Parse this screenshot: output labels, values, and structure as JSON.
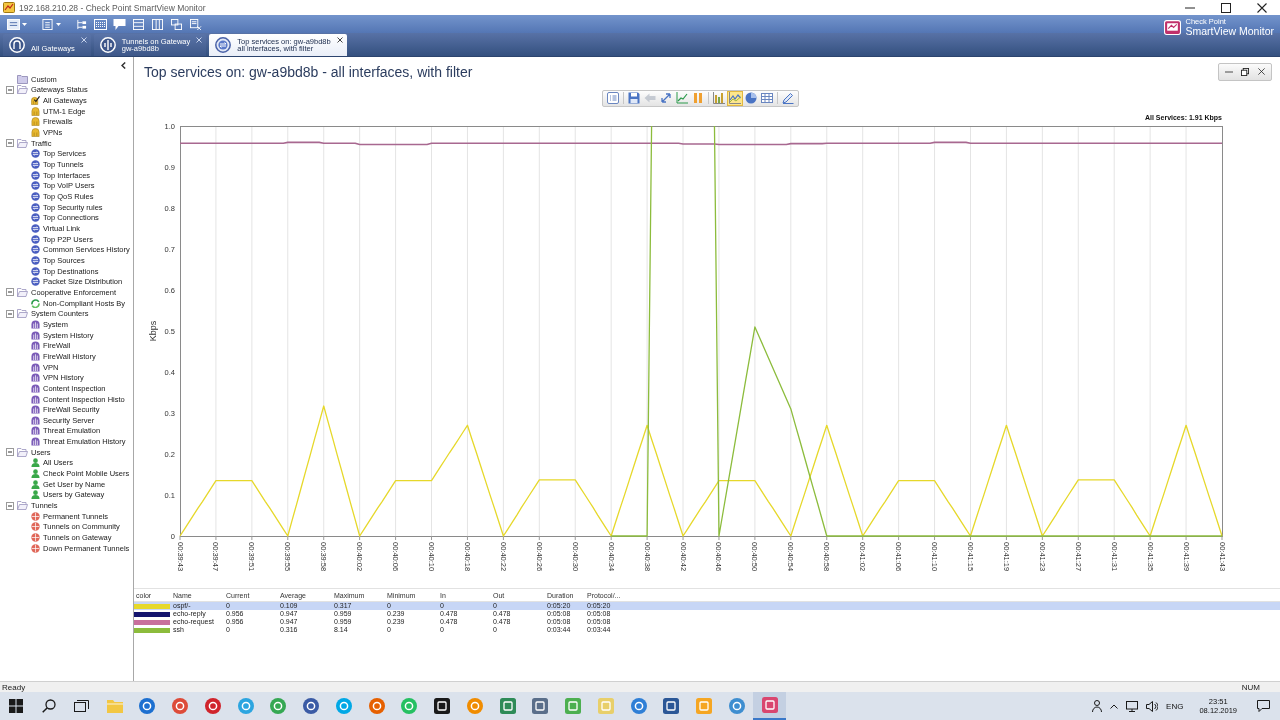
{
  "window": {
    "title": "192.168.210.28 - Check Point SmartView Monitor"
  },
  "tabs": [
    {
      "kind": "gateways",
      "lines": [
        "All Gateways"
      ],
      "selected": false
    },
    {
      "kind": "tunnels",
      "lines": [
        "Tunnels on Gateway",
        "gw-a9bd8b"
      ],
      "selected": false
    },
    {
      "kind": "services",
      "lines": [
        "Top services on: gw-a9bd8b",
        "all interfaces, with filter"
      ],
      "selected": true
    }
  ],
  "logo": {
    "brand": "Check Point",
    "product": "SmartView Monitor"
  },
  "sidebar": {
    "items": [
      {
        "label": "Custom"
      },
      {
        "label": "Gateways Status",
        "expanded": true,
        "children": [
          {
            "label": "All Gateways",
            "kind": "summary"
          },
          {
            "label": "UTM-1 Edge",
            "kind": "gateway"
          },
          {
            "label": "Firewalls",
            "kind": "gateway"
          },
          {
            "label": "VPNs",
            "kind": "gateway"
          }
        ]
      },
      {
        "label": "Traffic",
        "expanded": true,
        "children": [
          {
            "label": "Top Services",
            "kind": "traffic"
          },
          {
            "label": "Top Tunnels",
            "kind": "traffic"
          },
          {
            "label": "Top Interfaces",
            "kind": "traffic"
          },
          {
            "label": "Top VoIP Users",
            "kind": "traffic"
          },
          {
            "label": "Top QoS Rules",
            "kind": "traffic"
          },
          {
            "label": "Top Security rules",
            "kind": "traffic"
          },
          {
            "label": "Top Connections",
            "kind": "traffic"
          },
          {
            "label": "Virtual Link",
            "kind": "traffic"
          },
          {
            "label": "Top P2P Users",
            "kind": "traffic"
          },
          {
            "label": "Common Services History",
            "kind": "traffic"
          },
          {
            "label": "Top Sources",
            "kind": "traffic"
          },
          {
            "label": "Top Destinations",
            "kind": "traffic"
          },
          {
            "label": "Packet Size Distribution",
            "kind": "traffic"
          }
        ]
      },
      {
        "label": "Cooperative Enforcement",
        "expanded": true,
        "children": [
          {
            "label": "Non-Compliant Hosts By",
            "kind": "enforcement"
          }
        ]
      },
      {
        "label": "System Counters",
        "expanded": true,
        "children": [
          {
            "label": "System",
            "kind": "counter"
          },
          {
            "label": "System History",
            "kind": "counter"
          },
          {
            "label": "FireWall",
            "kind": "counter"
          },
          {
            "label": "FireWall History",
            "kind": "counter"
          },
          {
            "label": "VPN",
            "kind": "counter"
          },
          {
            "label": "VPN History",
            "kind": "counter"
          },
          {
            "label": "Content Inspection",
            "kind": "counter"
          },
          {
            "label": "Content Inspection Histo",
            "kind": "counter"
          },
          {
            "label": "FireWall Security",
            "kind": "counter"
          },
          {
            "label": "Security Server",
            "kind": "counter"
          },
          {
            "label": "Threat Emulation",
            "kind": "counter"
          },
          {
            "label": "Threat Emulation History",
            "kind": "counter"
          }
        ]
      },
      {
        "label": "Users",
        "expanded": true,
        "children": [
          {
            "label": "All Users",
            "kind": "user"
          },
          {
            "label": "Check Point Mobile Users",
            "kind": "user"
          },
          {
            "label": "Get User by Name",
            "kind": "user"
          },
          {
            "label": "Users by Gateway",
            "kind": "user"
          }
        ]
      },
      {
        "label": "Tunnels",
        "expanded": true,
        "children": [
          {
            "label": "Permanent Tunnels",
            "kind": "tunnel"
          },
          {
            "label": "Tunnels on Community",
            "kind": "tunnel"
          },
          {
            "label": "Tunnels on Gateway",
            "kind": "tunnel"
          },
          {
            "label": "Down Permanent Tunnels",
            "kind": "tunnel"
          }
        ]
      }
    ]
  },
  "view": {
    "title": "Top services on: gw-a9bd8b - all interfaces, with filter",
    "tool_groups": [
      {
        "tools": [
          {
            "kind": "legend",
            "disabled": false
          }
        ]
      },
      {
        "tools": [
          {
            "kind": "save",
            "disabled": false
          },
          {
            "kind": "back",
            "disabled": true
          },
          {
            "kind": "fit",
            "disabled": false
          },
          {
            "kind": "trend",
            "disabled": false
          },
          {
            "kind": "pause",
            "disabled": false
          }
        ]
      },
      {
        "tools": [
          {
            "kind": "bar",
            "disabled": false,
            "selected": false
          },
          {
            "kind": "line",
            "disabled": false,
            "selected": true
          },
          {
            "kind": "pie",
            "disabled": false,
            "selected": false
          },
          {
            "kind": "table",
            "disabled": false,
            "selected": false
          }
        ]
      },
      {
        "tools": [
          {
            "kind": "edit",
            "disabled": false
          }
        ]
      }
    ],
    "chart": {
      "total": "All Services: 1.91 Kbps",
      "chart_data": {
        "type": "line",
        "ylabel": "Kbps",
        "grid": true,
        "categories": [
          "00:39:43",
          null,
          null,
          null,
          null,
          null,
          null,
          null,
          "00:39:47",
          null,
          null,
          null,
          null,
          null,
          null,
          null,
          "00:39:51",
          null,
          null,
          null,
          null,
          null,
          null,
          null,
          "00:39:55",
          null,
          null,
          null,
          null,
          null,
          null,
          null,
          "00:39:58",
          null,
          null,
          null,
          null,
          null,
          null,
          null,
          "00:40:02",
          null,
          null,
          null,
          null,
          null,
          null,
          null,
          "00:40:06",
          null,
          null,
          null,
          null,
          null,
          null,
          null,
          "00:40:10",
          null,
          null,
          null,
          null,
          null,
          null,
          null,
          "00:40:18",
          null,
          null,
          null,
          null,
          null,
          null,
          null,
          "00:40:22",
          null,
          null,
          null,
          null,
          null,
          null,
          null,
          "00:40:26",
          null,
          null,
          null,
          null,
          null,
          null,
          null,
          "00:40:30",
          null,
          null,
          null,
          null,
          null,
          null,
          null,
          "00:40:34",
          null,
          null,
          null,
          null,
          null,
          null,
          null,
          "00:40:38",
          null,
          null,
          null,
          null,
          null,
          null,
          null,
          "00:40:42",
          null,
          null,
          null,
          null,
          null,
          null,
          null,
          "00:40:46",
          null,
          null,
          null,
          null,
          null,
          null,
          null,
          "00:40:50",
          null,
          null,
          null,
          null,
          null,
          null,
          null,
          "00:40:54",
          null,
          null,
          null,
          null,
          null,
          null,
          null,
          "00:40:58",
          null,
          null,
          null,
          null,
          null,
          null,
          null,
          "00:41:02",
          null,
          null,
          null,
          null,
          null,
          null,
          null,
          "00:41:06",
          null,
          null,
          null,
          null,
          null,
          null,
          null,
          "00:41:10",
          null,
          null,
          null,
          null,
          null,
          null,
          null,
          "00:41:15",
          null,
          null,
          null,
          null,
          null,
          null,
          null,
          "00:41:19",
          null,
          null,
          null,
          null,
          null,
          null,
          null,
          "00:41:23",
          null,
          null,
          null,
          null,
          null,
          null,
          null,
          "00:41:27",
          null,
          null,
          null,
          null,
          null,
          null,
          null,
          "00:41:31",
          null,
          null,
          null,
          null,
          null,
          null,
          null,
          "00:41:35",
          null,
          null,
          null,
          null,
          null,
          null,
          null,
          "00:41:39",
          null,
          null,
          null,
          null,
          null,
          null,
          null,
          "00:41:43"
        ],
        "series": [
          {
            "color": "#a86890",
            "values": [
              0.958,
              0.958,
              0.958,
              0.958,
              0.958,
              0.958,
              0.958,
              0.958,
              0.958,
              0.958,
              0.958,
              0.958,
              0.958,
              0.958,
              0.958,
              0.958,
              0.958,
              0.958,
              0.958,
              0.958,
              0.958,
              0.958,
              0.958,
              0.958,
              0.96,
              0.96,
              0.96,
              0.96,
              0.96,
              0.96,
              0.96,
              0.96,
              0.958,
              0.958,
              0.958,
              0.958,
              0.958,
              0.958,
              0.958,
              0.958,
              0.955,
              0.955,
              0.955,
              0.955,
              0.955,
              0.955,
              0.955,
              0.955,
              0.955,
              0.955,
              0.955,
              0.955,
              0.955,
              0.955,
              0.955,
              0.955,
              0.958,
              0.958,
              0.958,
              0.958,
              0.958,
              0.958,
              0.958,
              0.958,
              0.958,
              0.958,
              0.958,
              0.958,
              0.958,
              0.958,
              0.958,
              0.958,
              0.958,
              0.958,
              0.958,
              0.958,
              0.958,
              0.958,
              0.958,
              0.958,
              0.958,
              0.958,
              0.958,
              0.958,
              0.958,
              0.958,
              0.958,
              0.958,
              0.958,
              0.958,
              0.958,
              0.958,
              0.958,
              0.958,
              0.958,
              0.958,
              0.958,
              0.958,
              0.958,
              0.958,
              0.958,
              0.958,
              0.958,
              0.958,
              0.958,
              0.958,
              0.958,
              0.958,
              0.958,
              0.958,
              0.958,
              0.958,
              0.956,
              0.956,
              0.956,
              0.956,
              0.956,
              0.956,
              0.956,
              0.956,
              0.955,
              0.955,
              0.955,
              0.955,
              0.955,
              0.955,
              0.955,
              0.955,
              0.955,
              0.955,
              0.955,
              0.955,
              0.955,
              0.955,
              0.955,
              0.955,
              0.957,
              0.957,
              0.957,
              0.957,
              0.957,
              0.957,
              0.957,
              0.957,
              0.958,
              0.958,
              0.958,
              0.958,
              0.958,
              0.958,
              0.958,
              0.958,
              0.958,
              0.958,
              0.958,
              0.958,
              0.958,
              0.958,
              0.958,
              0.958,
              0.958,
              0.958,
              0.958,
              0.958,
              0.958,
              0.958,
              0.958,
              0.958,
              0.96,
              0.96,
              0.96,
              0.96,
              0.96,
              0.96,
              0.96,
              0.96,
              0.958,
              0.958,
              0.958,
              0.958,
              0.958,
              0.958,
              0.958,
              0.958,
              0.958,
              0.958,
              0.958,
              0.958,
              0.958,
              0.958,
              0.958,
              0.958,
              0.958,
              0.958,
              0.958,
              0.958,
              0.958,
              0.958,
              0.958,
              0.958,
              0.958,
              0.958,
              0.958,
              0.958,
              0.958,
              0.958,
              0.958,
              0.958,
              0.958,
              0.958,
              0.958,
              0.958,
              0.958,
              0.958,
              0.958,
              0.958,
              0.958,
              0.958,
              0.958,
              0.958,
              0.958,
              0.958,
              0.958,
              0.958,
              0.958,
              0.958,
              0.958,
              0.958,
              0.958,
              0.958,
              0.958,
              0.958,
              0.958
            ]
          },
          {
            "color": "#e6d82a",
            "values": [
              0,
              0.017,
              0.034,
              0.051,
              0.068,
              0.084,
              0.101,
              0.118,
              0.135,
              0.135,
              0.135,
              0.135,
              0.135,
              0.135,
              0.135,
              0.135,
              0.135,
              0.118,
              0.101,
              0.084,
              0.068,
              0.051,
              0.034,
              0.017,
              0,
              0.04,
              0.079,
              0.119,
              0.159,
              0.198,
              0.238,
              0.277,
              0.317,
              0.277,
              0.238,
              0.198,
              0.159,
              0.119,
              0.079,
              0.04,
              0,
              0.017,
              0.034,
              0.051,
              0.068,
              0.084,
              0.101,
              0.118,
              0.135,
              0.135,
              0.135,
              0.135,
              0.135,
              0.135,
              0.135,
              0.135,
              0.135,
              0.152,
              0.169,
              0.186,
              0.203,
              0.219,
              0.236,
              0.253,
              0.27,
              0.236,
              0.203,
              0.169,
              0.135,
              0.101,
              0.068,
              0.034,
              0,
              0.017,
              0.034,
              0.051,
              0.069,
              0.086,
              0.103,
              0.12,
              0.137,
              0.137,
              0.137,
              0.137,
              0.137,
              0.137,
              0.137,
              0.137,
              0.137,
              0.12,
              0.103,
              0.086,
              0.069,
              0.051,
              0.034,
              0.017,
              0,
              0.034,
              0.068,
              0.101,
              0.135,
              0.169,
              0.203,
              0.236,
              0.27,
              0.236,
              0.203,
              0.169,
              0.135,
              0.101,
              0.068,
              0.034,
              0,
              0.017,
              0.034,
              0.051,
              0.068,
              0.084,
              0.101,
              0.118,
              0.135,
              0.135,
              0.135,
              0.135,
              0.135,
              0.135,
              0.135,
              0.135,
              0.135,
              0.118,
              0.101,
              0.084,
              0.068,
              0.051,
              0.034,
              0.017,
              0,
              0.034,
              0.068,
              0.101,
              0.135,
              0.169,
              0.203,
              0.236,
              0.27,
              0.236,
              0.203,
              0.169,
              0.135,
              0.101,
              0.068,
              0.034,
              0,
              0.017,
              0.034,
              0.051,
              0.068,
              0.084,
              0.101,
              0.118,
              0.135,
              0.135,
              0.135,
              0.135,
              0.135,
              0.135,
              0.135,
              0.135,
              0.135,
              0.118,
              0.101,
              0.084,
              0.068,
              0.051,
              0.034,
              0.017,
              0,
              0.034,
              0.068,
              0.101,
              0.135,
              0.169,
              0.203,
              0.236,
              0.27,
              0.236,
              0.203,
              0.169,
              0.135,
              0.101,
              0.068,
              0.034,
              0,
              0.017,
              0.034,
              0.051,
              0.069,
              0.086,
              0.103,
              0.12,
              0.137,
              0.137,
              0.137,
              0.137,
              0.137,
              0.137,
              0.137,
              0.137,
              0.137,
              0.12,
              0.103,
              0.086,
              0.069,
              0.051,
              0.034,
              0.017,
              0,
              0.034,
              0.068,
              0.101,
              0.135,
              0.169,
              0.203,
              0.236,
              0.27,
              0.236,
              0.203,
              0.169,
              0.135,
              0.101,
              0.068,
              0.034,
              0
            ]
          },
          {
            "color": "#8cbc3c",
            "values": [
              null,
              null,
              null,
              null,
              null,
              null,
              null,
              null,
              null,
              null,
              null,
              null,
              null,
              null,
              null,
              null,
              null,
              null,
              null,
              null,
              null,
              null,
              null,
              null,
              null,
              null,
              null,
              null,
              null,
              null,
              null,
              null,
              null,
              null,
              null,
              null,
              null,
              null,
              null,
              null,
              null,
              null,
              null,
              null,
              null,
              null,
              null,
              null,
              null,
              null,
              null,
              null,
              null,
              null,
              null,
              null,
              null,
              null,
              null,
              null,
              null,
              null,
              null,
              null,
              null,
              null,
              null,
              null,
              null,
              null,
              null,
              null,
              null,
              null,
              null,
              null,
              null,
              null,
              null,
              null,
              null,
              null,
              null,
              null,
              null,
              null,
              null,
              null,
              null,
              null,
              null,
              null,
              null,
              null,
              null,
              null,
              0,
              0,
              0,
              0,
              0,
              0,
              0,
              0,
              0,
              1,
              null,
              null,
              null,
              null,
              null,
              null,
              null,
              null,
              null,
              null,
              null,
              null,
              null,
              1,
              0,
              0.064,
              0.128,
              0.191,
              0.255,
              0.319,
              0.383,
              0.446,
              0.51,
              0.485,
              0.46,
              0.435,
              0.41,
              0.385,
              0.36,
              0.335,
              0.31,
              0.271,
              0.233,
              0.194,
              0.155,
              0.116,
              0.078,
              0.039,
              0,
              0,
              0,
              0,
              0,
              0,
              0,
              0,
              0,
              0,
              0,
              0,
              0,
              0,
              0,
              0,
              0,
              0,
              0,
              0,
              0,
              0,
              0,
              0,
              0,
              0,
              0,
              0,
              0,
              0,
              0,
              0,
              0,
              0,
              0,
              0,
              0,
              0,
              0,
              0,
              0,
              0,
              0,
              0,
              0,
              0,
              0,
              0,
              0,
              0,
              0,
              0,
              0,
              0,
              0,
              0,
              0,
              0,
              0,
              0,
              0,
              0,
              0,
              0,
              0,
              0,
              0,
              0,
              0,
              0,
              0,
              0,
              0,
              0,
              0,
              0,
              0,
              0,
              0,
              0,
              0,
              0,
              0,
              0,
              0,
              0,
              0,
              0,
              0
            ]
          }
        ],
        "ylim": [
          0,
          1
        ],
        "yticks": [
          {
            "value": 0,
            "label": "0"
          },
          {
            "value": 0.1,
            "label": "0.1"
          },
          {
            "value": 0.2,
            "label": "0.2"
          },
          {
            "value": 0.3,
            "label": "0.3"
          },
          {
            "value": 0.4,
            "label": "0.4"
          },
          {
            "value": 0.5,
            "label": "0.5"
          },
          {
            "value": 0.6,
            "label": "0.6"
          },
          {
            "value": 0.7,
            "label": "0.7"
          },
          {
            "value": 0.8,
            "label": "0.8"
          },
          {
            "value": 0.9,
            "label": "0.9"
          },
          {
            "value": 1,
            "label": "1.0"
          }
        ]
      }
    },
    "table": {
      "columns": [
        "color",
        "Name",
        "Current",
        "Average",
        "Maximum",
        "Minimum",
        "In",
        "Out",
        "Duration",
        "Protocol/..."
      ],
      "rows": [
        {
          "color": "#e6d82a",
          "selected": true,
          "cells": [
            "",
            "ospf/-",
            "0",
            "0.109",
            "0.317",
            "0",
            "0",
            "0",
            "0:05:20",
            "0:05:20"
          ]
        },
        {
          "color": "#14146e",
          "selected": false,
          "cells": [
            "",
            "echo-reply",
            "0.956",
            "0.947",
            "0.959",
            "0.239",
            "0.478",
            "0.478",
            "0:05:08",
            "0:05:08"
          ]
        },
        {
          "color": "#c8709c",
          "selected": false,
          "cells": [
            "",
            "echo-request",
            "0.956",
            "0.947",
            "0.959",
            "0.239",
            "0.478",
            "0.478",
            "0:05:08",
            "0:05:08"
          ]
        },
        {
          "color": "#8cbc3c",
          "selected": false,
          "cells": [
            "",
            "ssh",
            "0",
            "0.316",
            "8.14",
            "0",
            "0",
            "0",
            "0:03:44",
            "0:03:44"
          ]
        }
      ]
    }
  },
  "status_bar": {
    "left": "Ready",
    "right": "NUM"
  },
  "taskbar": {
    "apps": [
      {
        "kind": "folder",
        "color": "#f2c744",
        "active": false
      },
      {
        "kind": "disc",
        "color": "#1c6fd0",
        "active": false
      },
      {
        "kind": "disc",
        "color": "#dd4b39",
        "active": false
      },
      {
        "kind": "disc",
        "color": "#d0242c",
        "active": false
      },
      {
        "kind": "disc",
        "color": "#2ca5e0",
        "active": false
      },
      {
        "kind": "disc",
        "color": "#35a853",
        "active": false
      },
      {
        "kind": "disc",
        "color": "#3b5ba5",
        "active": false
      },
      {
        "kind": "disc",
        "color": "#00a8e6",
        "active": false
      },
      {
        "kind": "disc",
        "color": "#e66000",
        "active": false
      },
      {
        "kind": "disc",
        "color": "#25c062",
        "active": false
      },
      {
        "kind": "square",
        "color": "#1a1a1a",
        "active": false
      },
      {
        "kind": "disc",
        "color": "#f08c00",
        "active": false
      },
      {
        "kind": "square",
        "color": "#2e8b57",
        "active": false
      },
      {
        "kind": "square",
        "color": "#5a6e8a",
        "active": false
      },
      {
        "kind": "square",
        "color": "#4caf50",
        "active": false
      },
      {
        "kind": "square",
        "color": "#e8cf6a",
        "active": false
      },
      {
        "kind": "disc",
        "color": "#2f7fd6",
        "active": false
      },
      {
        "kind": "square",
        "color": "#2b5797",
        "active": false
      },
      {
        "kind": "square",
        "color": "#f5a623",
        "active": false
      },
      {
        "kind": "disc",
        "color": "#3e8ed0",
        "active": false
      },
      {
        "kind": "square",
        "color": "#d9466f",
        "active": true
      }
    ],
    "language": "ENG",
    "time": "23:51",
    "date": "08.12.2019"
  }
}
